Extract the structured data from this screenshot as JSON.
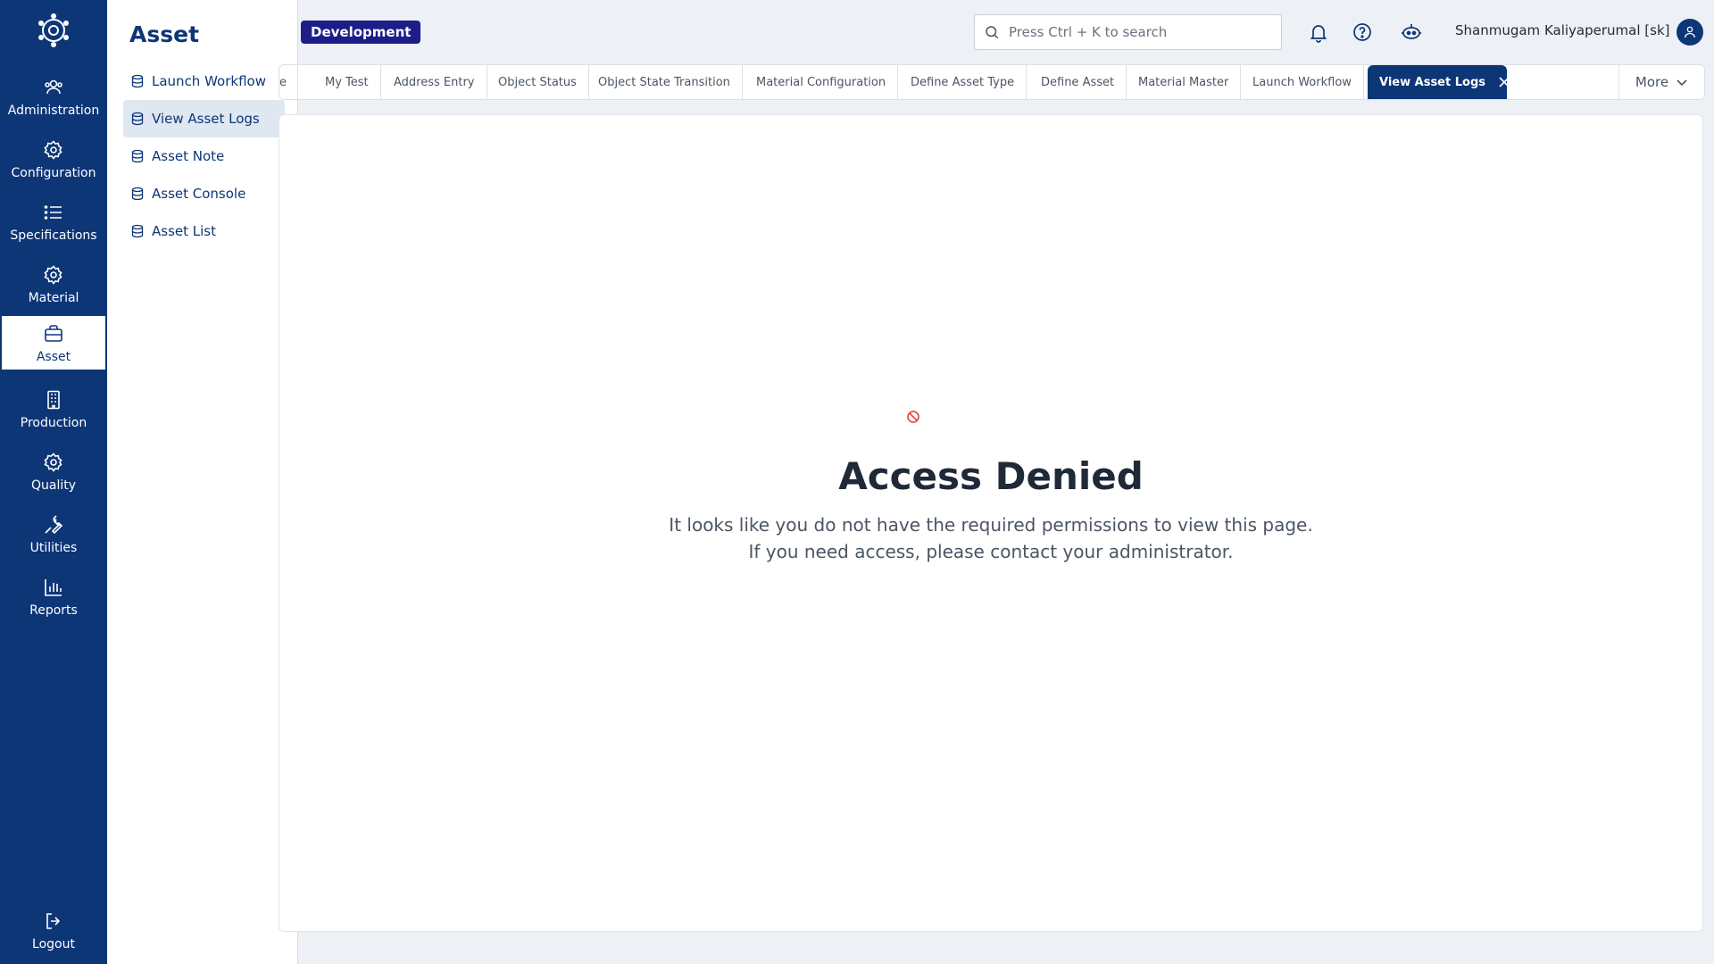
{
  "rail": {
    "items": [
      {
        "label": "Administration",
        "icon": "users-icon"
      },
      {
        "label": "Configuration",
        "icon": "gear-icon"
      },
      {
        "label": "Specifications",
        "icon": "list-icon"
      },
      {
        "label": "Material",
        "icon": "gear-icon"
      },
      {
        "label": "Asset",
        "icon": "briefcase-icon"
      },
      {
        "label": "Production",
        "icon": "building-icon"
      },
      {
        "label": "Quality",
        "icon": "gear-icon"
      },
      {
        "label": "Utilities",
        "icon": "wrench-icon"
      },
      {
        "label": "Reports",
        "icon": "bar-chart-icon"
      }
    ],
    "active": "Asset",
    "logout": "Logout"
  },
  "flyout": {
    "title": "Asset",
    "items": [
      {
        "label": "Launch Workflow"
      },
      {
        "label": "View Asset Logs"
      },
      {
        "label": "Asset Note"
      },
      {
        "label": "Asset Console"
      },
      {
        "label": "Asset List"
      }
    ],
    "active": "View Asset Logs"
  },
  "header": {
    "environment_badge": "Development",
    "search_placeholder": "Press Ctrl + K to search",
    "user_name": "Shanmugam Kaliyaperumal [sk]"
  },
  "tabs": {
    "items": [
      {
        "label": "e"
      },
      {
        "label": "My Test"
      },
      {
        "label": "Address Entry"
      },
      {
        "label": "Object Status"
      },
      {
        "label": "Object State Transition"
      },
      {
        "label": "Material Configuration"
      },
      {
        "label": "Define Asset Type"
      },
      {
        "label": "Define Asset"
      },
      {
        "label": "Material Master"
      },
      {
        "label": "Launch Workflow"
      },
      {
        "label": "View Asset Logs"
      }
    ],
    "active": "View Asset Logs",
    "more_label": "More"
  },
  "content": {
    "title": "Access Denied",
    "message_line1": "It looks like you do not have the required permissions to view this page.",
    "message_line2": "If you need access, please contact your administrator."
  },
  "colors": {
    "primary": "#0d3677",
    "badge": "#1d1d8a",
    "denied_icon": "#e53935"
  }
}
